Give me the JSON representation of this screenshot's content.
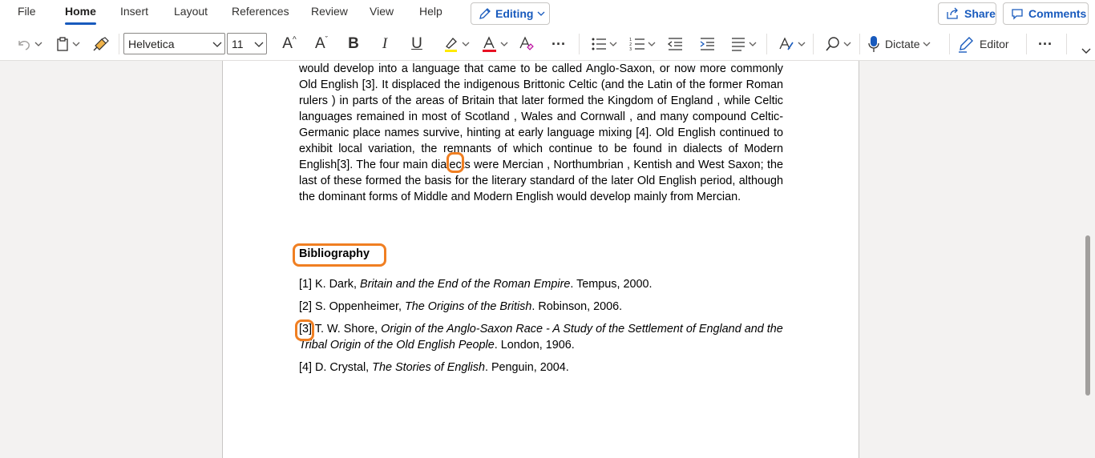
{
  "menu": {
    "tabs": [
      {
        "label": "File"
      },
      {
        "label": "Home"
      },
      {
        "label": "Insert"
      },
      {
        "label": "Layout"
      },
      {
        "label": "References"
      },
      {
        "label": "Review"
      },
      {
        "label": "View"
      },
      {
        "label": "Help"
      }
    ],
    "active_tab": "Home",
    "editing_label": "Editing",
    "share_label": "Share",
    "comments_label": "Comments"
  },
  "toolbar": {
    "font_name": "Helvetica",
    "font_size": "11",
    "dictate_label": "Dictate",
    "editor_label": "Editor",
    "more_glyph": "···",
    "accent_color": "#185abd",
    "highlight_color": "#ffea00",
    "font_color": "#e81123"
  },
  "document": {
    "para_segments": [
      "would develop into a language that came to be called Anglo-Saxon, or now more commonly Old English [3]. It displaced the indigenous Brittonic Celtic (and the Latin of the former Roman rulers ) in parts of the areas of Britain that later formed the Kingdom of England , while Celtic languages remained in most of Scotland , Wales and Cornwall , and many compound Celtic-Germanic place names survive, hinting at early language mixing [4]. Old English continued to exhibit local variation, the remnants of which continue to be found in dialects of Modern English",
      "[3]",
      ". The four main dialects were Mercian , Northumbrian , Kentish and West Saxon; the last of these formed the basis for the literary standard of the later Old English period, although the dominant forms of Middle and Modern English would develop mainly from Mercian."
    ],
    "heading": "Bibliography",
    "bibliography": [
      {
        "ref": "[1]",
        "author": "K. Dark, ",
        "title": "Britain and the End of the Roman Empire",
        "rest": ". Tempus, 2000."
      },
      {
        "ref": "[2]",
        "author": "S. Oppenheimer, ",
        "title": "The Origins of the British",
        "rest": ". Robinson, 2006."
      },
      {
        "ref": "[3]",
        "author": "T. W. Shore, ",
        "title": "Origin of the Anglo-Saxon Race - A Study of the Settlement of England and the Tribal Origin of the Old English People",
        "rest": ". London, 1906."
      },
      {
        "ref": "[4]",
        "author": "D. Crystal, ",
        "title": "The Stories of English",
        "rest": ". Penguin, 2004."
      }
    ],
    "highlight_color": "#f07f22"
  }
}
